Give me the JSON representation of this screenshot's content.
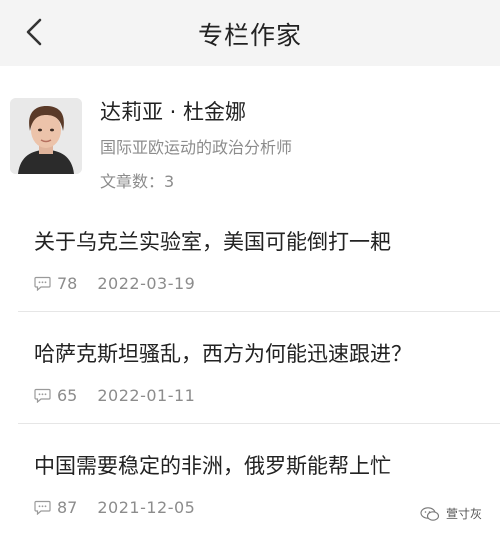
{
  "header": {
    "title": "专栏作家"
  },
  "author": {
    "name": "达莉亚 · 杜金娜",
    "title": "国际亚欧运动的政治分析师",
    "article_count_label": "文章数：3"
  },
  "articles": [
    {
      "title": "关于乌克兰实验室，美国可能倒打一耙",
      "comments": "78",
      "date": "2022-03-19"
    },
    {
      "title": "哈萨克斯坦骚乱，西方为何能迅速跟进？",
      "comments": "65",
      "date": "2022-01-11"
    },
    {
      "title": "中国需要稳定的非洲，俄罗斯能帮上忙",
      "comments": "87",
      "date": "2021-12-05"
    }
  ],
  "watermark": {
    "text": "萱寸灰"
  },
  "icons": {
    "back": "chevron-left-icon",
    "comment": "comment-bubble-icon",
    "watermark": "wechat-logo-icon"
  },
  "colors": {
    "nav_background": "#f4f4f4",
    "primary_text": "#222222",
    "secondary_text": "#8c8c8c",
    "divider": "#e6e6e6"
  }
}
